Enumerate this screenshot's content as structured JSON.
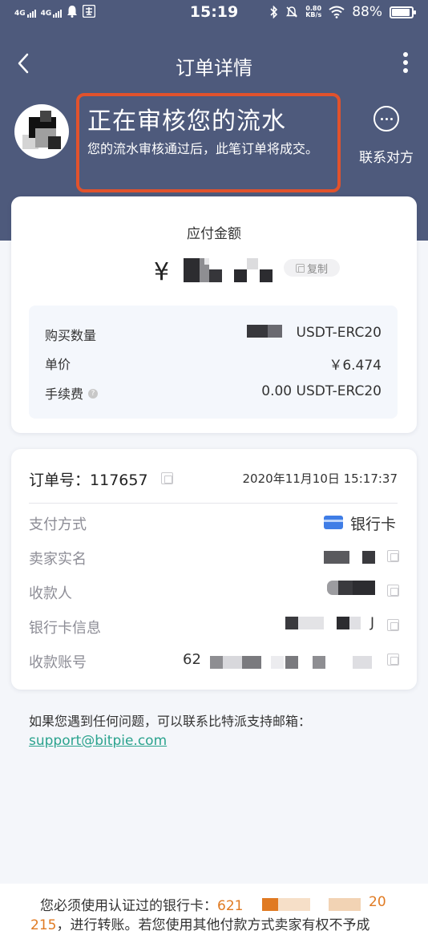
{
  "status_bar": {
    "net1": "4G",
    "net2": "4G",
    "time": "15:19",
    "speed_value": "0.80",
    "speed_unit": "KB/s",
    "battery": "88%"
  },
  "nav": {
    "title": "订单详情"
  },
  "review": {
    "title": "正在审核您的流水",
    "subtitle": "您的流水审核通过后，此笔订单将成交。"
  },
  "contact": {
    "label": "联系对方"
  },
  "payment": {
    "label": "应付金额",
    "currency_symbol": "¥",
    "copy_label": "复制",
    "details": [
      {
        "key": "购买数量",
        "value": "USDT-ERC20"
      },
      {
        "key": "单价",
        "value": "￥6.474"
      },
      {
        "key": "手续费",
        "value": "0.00 USDT-ERC20"
      }
    ]
  },
  "order": {
    "number_label": "订单号：",
    "number": "117657",
    "time": "2020年11月10日 15:17:37",
    "rows": [
      {
        "key": "支付方式",
        "value": "银行卡"
      },
      {
        "key": "卖家实名",
        "value": ""
      },
      {
        "key": "收款人",
        "value": ""
      },
      {
        "key": "银行卡信息",
        "value": "J"
      },
      {
        "key": "收款账号",
        "value": "62"
      }
    ]
  },
  "support": {
    "text": "如果您遇到任何问题，可以联系比特派支持邮箱：",
    "email": "support@bitpie.com"
  },
  "notice": {
    "line1_prefix": "您必须使用认证过的银行卡：",
    "line1_num_start": "621",
    "line1_num_end": "20",
    "line2_num": "215",
    "line2_text": "，进行转账。若您使用其他付款方式卖家有权不予成"
  },
  "colors": {
    "header_bg": "#4e5a7c",
    "highlight_border": "#e1522c",
    "link": "#2ba38e",
    "card_icon": "#3f7de6"
  }
}
